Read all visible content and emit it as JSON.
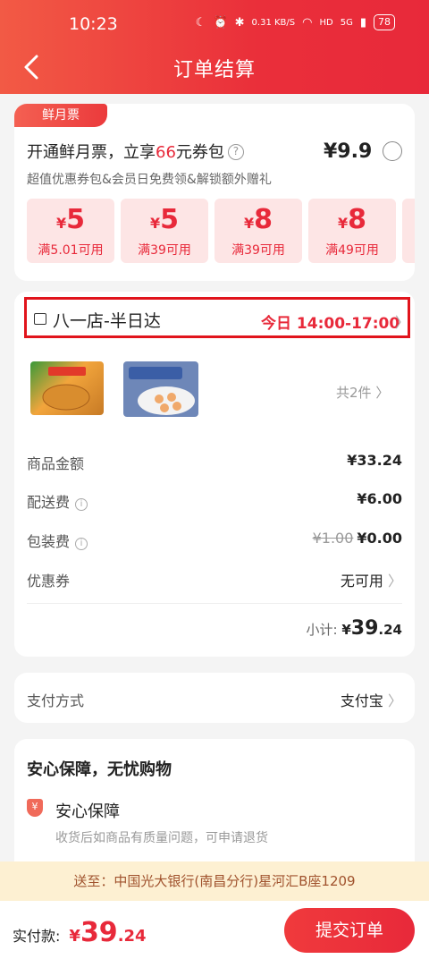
{
  "status_bar": {
    "time": "10:23",
    "network_speed": "0.31 KB/S",
    "hd": "HD",
    "signal": "5G",
    "battery": "78"
  },
  "header": {
    "title": "订单结算"
  },
  "membership": {
    "tag": "鲜月票",
    "title_prefix": "开通鲜月票，立享",
    "title_highlight": "66",
    "title_suffix": "元券包",
    "price": "¥9.9",
    "subtitle": "超值优惠券包&会员日免费领&解锁额外赠礼",
    "coupons": [
      {
        "currency": "¥",
        "amount": "5",
        "condition": "满5.01可用"
      },
      {
        "currency": "¥",
        "amount": "5",
        "condition": "满39可用"
      },
      {
        "currency": "¥",
        "amount": "8",
        "condition": "满39可用"
      },
      {
        "currency": "¥",
        "amount": "8",
        "condition": "满49可用"
      }
    ]
  },
  "order": {
    "store_name": "八一店-半日达",
    "delivery_time": "今日 14:00-17:00",
    "product_count": "共2件",
    "rows": {
      "goods_amount": {
        "label": "商品金额",
        "value": "¥33.24"
      },
      "delivery_fee": {
        "label": "配送费",
        "value": "¥6.00"
      },
      "packing_fee": {
        "label": "包装费",
        "original": "¥1.00",
        "value": "¥0.00"
      },
      "coupon": {
        "label": "优惠券",
        "value": "无可用"
      }
    },
    "subtotal": {
      "label": "小计:",
      "currency": "¥",
      "integer": "39",
      "decimal": ".24"
    }
  },
  "payment": {
    "label": "支付方式",
    "value": "支付宝"
  },
  "guarantee": {
    "title": "安心保障，无忧购物",
    "item_name": "安心保障",
    "item_desc": "收货后如商品有质量问题，可申请退货"
  },
  "address": {
    "text": "送至：中国光大银行(南昌分行)星河汇B座1209"
  },
  "footer": {
    "label": "实付款:",
    "currency": "¥",
    "integer": "39",
    "decimal": ".24",
    "submit": "提交订单"
  },
  "colors": {
    "brand_red": "#e8293a",
    "coupon_bg": "#fde5e5",
    "address_bg": "#fdf0d2"
  }
}
